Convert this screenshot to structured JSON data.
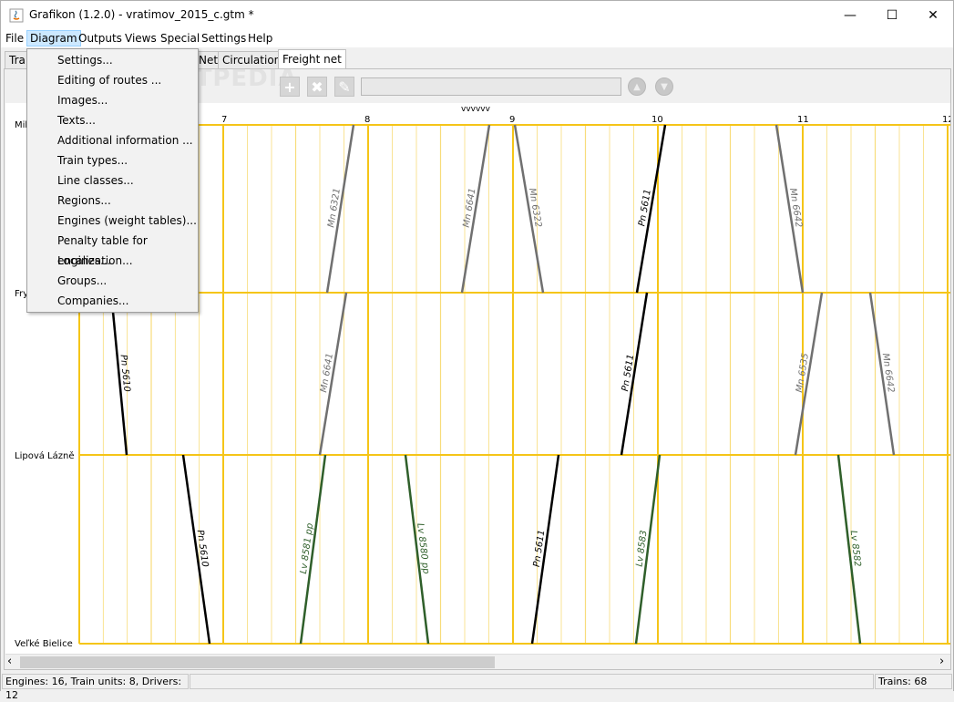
{
  "window": {
    "title": "Grafikon (1.2.0) - vratimov_2015_c.gtm *",
    "minimize": "—",
    "maximize": "☐",
    "close": "✕"
  },
  "menubar": {
    "items": [
      "File",
      "Diagram",
      "Outputs",
      "Views",
      "Special",
      "Settings",
      "Help"
    ],
    "active": "Diagram"
  },
  "tabs": {
    "items": [
      "Trai",
      "Net",
      "Circulations",
      "Freight net"
    ],
    "active": "Freight net"
  },
  "toolbar": {
    "add": "+",
    "remove": "✖",
    "edit": "✎",
    "up": "▲",
    "down": "▼",
    "search_value": ""
  },
  "watermark": "SOFTPEDIA",
  "diagram_menu": {
    "items": [
      "Settings...",
      "Editing of routes ...",
      "Images...",
      "Texts...",
      "Additional information ...",
      "Train types...",
      "Line classes...",
      "Regions...",
      "Engines (weight tables)...",
      "Penalty table for engines...",
      "Localization...",
      "Groups...",
      "Companies..."
    ]
  },
  "graph": {
    "route_label": "vvvvvv",
    "hours": [
      "7",
      "8",
      "9",
      "10",
      "11",
      "12"
    ],
    "stations": [
      "Mik",
      "Fry",
      "Lipová Lázně",
      "Veľké Bielice"
    ],
    "colors": {
      "grid": "#f5c518",
      "grid_minor": "#f8dc7a",
      "black": "#000000",
      "gray": "#707070",
      "green": "#2f5f2a"
    },
    "trains": [
      {
        "name": "Mn 6321",
        "color": "gray"
      },
      {
        "name": "Mn 6641",
        "color": "gray"
      },
      {
        "name": "Mn 6322",
        "color": "gray"
      },
      {
        "name": "Pn 5611",
        "color": "black"
      },
      {
        "name": "Mn 6642",
        "color": "gray"
      },
      {
        "name": "Pn 5610",
        "color": "black"
      },
      {
        "name": "Mn 6641",
        "color": "gray"
      },
      {
        "name": "Pn 5611",
        "color": "black"
      },
      {
        "name": "Mn 6535",
        "color": "gray"
      },
      {
        "name": "Mn 6642",
        "color": "gray"
      },
      {
        "name": "Pn 5610",
        "color": "black"
      },
      {
        "name": "Lv 8581 pp",
        "color": "green"
      },
      {
        "name": "Lv 8580 pp",
        "color": "green"
      },
      {
        "name": "Pn 5611",
        "color": "black"
      },
      {
        "name": "Lv 8583",
        "color": "green"
      },
      {
        "name": "Lv 8582",
        "color": "green"
      }
    ]
  },
  "scroll": {
    "left": "‹",
    "right": "›"
  },
  "status": {
    "left": "Engines: 16, Train units: 8, Drivers: 12",
    "right": "Trains: 68"
  }
}
